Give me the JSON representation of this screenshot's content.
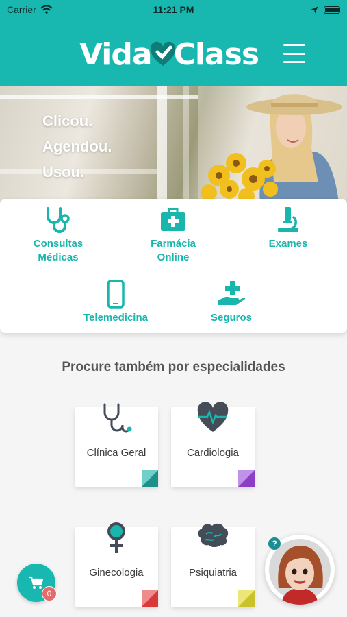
{
  "status_bar": {
    "carrier": "Carrier",
    "time": "11:21 PM"
  },
  "header": {
    "logo_left": "Vida",
    "logo_right": "Class",
    "brand_color": "#18b8b0",
    "menu_icon": "hamburger-menu-icon"
  },
  "banner": {
    "lines": [
      "Clicou.",
      "Agendou.",
      "Usou."
    ]
  },
  "services": [
    {
      "label": "Consultas\nMédicas",
      "icon": "stethoscope-icon"
    },
    {
      "label": "Farmácia\nOnline",
      "icon": "first-aid-kit-icon"
    },
    {
      "label": "Exames",
      "icon": "microscope-icon"
    },
    {
      "label": "Telemedicina",
      "icon": "smartphone-icon"
    },
    {
      "label": "Seguros",
      "icon": "hand-plus-icon"
    }
  ],
  "specialties": {
    "title": "Procure também por especialidades",
    "items": [
      {
        "label": "Clínica Geral",
        "icon": "stethoscope-icon",
        "color": "#1f8f8a"
      },
      {
        "label": "Cardiologia",
        "icon": "heartbeat-icon",
        "color": "#8b3fc4"
      },
      {
        "label": "Ginecologia",
        "icon": "female-symbol-icon",
        "color": "#d83a3a"
      },
      {
        "label": "Psiquiatria",
        "icon": "brain-icon",
        "color": "#c9c22a"
      }
    ]
  },
  "cart": {
    "count": "0",
    "icon": "shopping-cart-icon"
  },
  "assistant": {
    "help": "?",
    "icon": "assistant-avatar-icon"
  }
}
